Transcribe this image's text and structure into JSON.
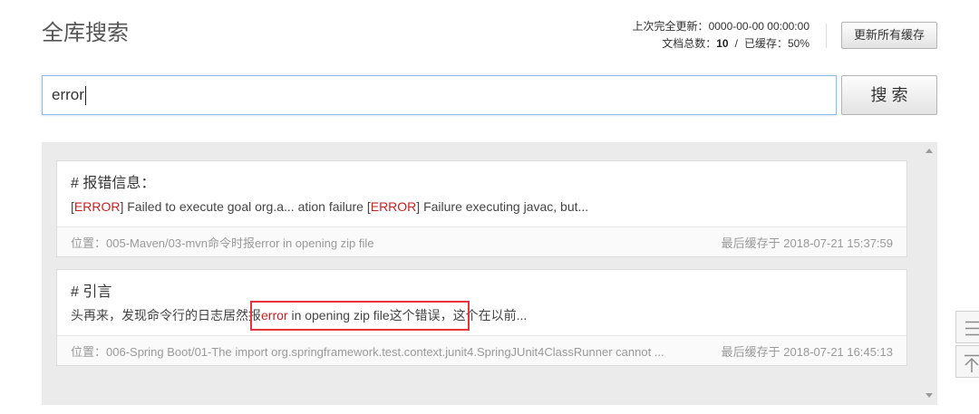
{
  "header": {
    "title": "全库搜索",
    "last_update_label": "上次完全更新：",
    "last_update_value": "0000-00-00 00:00:00",
    "doc_count_label": "文档总数：",
    "doc_count_value": "10",
    "separator": "/",
    "cached_label": "已缓存：",
    "cached_value": "50%",
    "refresh_button_label": "更新所有缓存"
  },
  "search": {
    "query": "error",
    "button_label": "搜 索"
  },
  "results": [
    {
      "title": "# 报错信息：",
      "snippet": [
        {
          "text": "[",
          "match": false
        },
        {
          "text": "ERROR",
          "match": true
        },
        {
          "text": "] Failed to execute goal org.a... ation failure [",
          "match": false
        },
        {
          "text": "ERROR",
          "match": true
        },
        {
          "text": "] Failure executing javac, but...",
          "match": false
        }
      ],
      "location": "位置：005-Maven/03-mvn命令时报error in opening zip file",
      "cached_at": "最后缓存于 2018-07-21 15:37:59"
    },
    {
      "title": "# 引言",
      "snippet": [
        {
          "text": "头再来，发现命令行的日志居然报",
          "match": false
        },
        {
          "text": "error",
          "match": true
        },
        {
          "text": " in opening zip file这个错误，这个在以前...",
          "match": false
        }
      ],
      "location": "位置：006-Spring Boot/01-The import org.springframework.test.context.junit4.SpringJUnit4ClassRunner cannot ...",
      "cached_at": "最后缓存于 2018-07-21 16:45:13"
    }
  ],
  "float_tools": [
    {
      "icon": "list-icon"
    },
    {
      "icon": "back-to-top-icon"
    }
  ],
  "colors": {
    "match_highlight": "#cc1f1f",
    "annotation_box": "#e8323c",
    "input_border": "#8fbde8",
    "panel_background": "#ebebeb"
  }
}
